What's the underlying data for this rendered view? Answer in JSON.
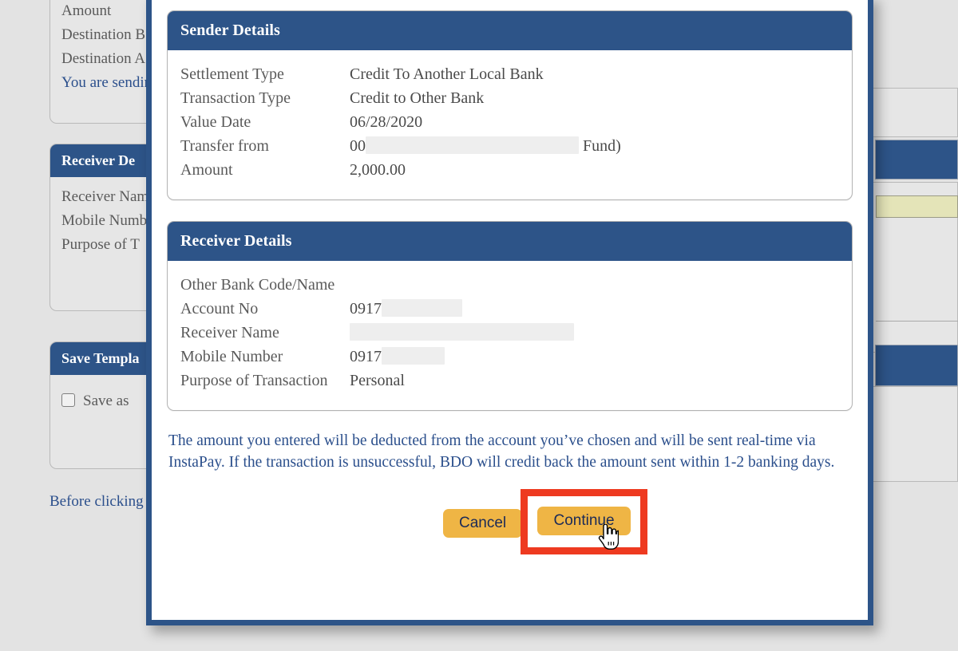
{
  "background": {
    "top_panel_rows": [
      "Amount",
      "Destination B",
      "Destination A",
      "You are sendin"
    ],
    "receiver_panel": {
      "title": "Receiver De",
      "rows": [
        "Receiver Nam",
        "",
        "Mobile Numb",
        "Purpose of T"
      ]
    },
    "save_template_panel": {
      "title": "Save Templa",
      "checkbox_label": "Save as"
    },
    "footer_note": "Before clicking"
  },
  "modal": {
    "sender": {
      "title": "Sender Details",
      "rows": [
        {
          "label": "Settlement Type",
          "value": "Credit To Another Local Bank",
          "redacted": false
        },
        {
          "label": "Transaction Type",
          "value": "Credit to Other Bank",
          "redacted": false
        },
        {
          "label": "Value Date",
          "value": "06/28/2020",
          "redacted": false
        },
        {
          "label": "Transfer from",
          "value_prefix": "00",
          "value_suffix": " Fund)",
          "redacted": "from"
        },
        {
          "label": "Amount",
          "value": "2,000.00",
          "redacted": false
        }
      ]
    },
    "receiver": {
      "title": "Receiver Details",
      "rows": [
        {
          "label": "Other Bank Code/Name",
          "value": "",
          "redacted": false
        },
        {
          "label": "Account No",
          "value_prefix": "0917",
          "value_suffix": "",
          "redacted": "acct"
        },
        {
          "label": "Receiver Name",
          "value_prefix": "",
          "value_suffix": "",
          "redacted": "name"
        },
        {
          "label": "Mobile Number",
          "value_prefix": "0917",
          "value_suffix": "",
          "redacted": "mobile"
        },
        {
          "label": "Purpose of Transaction",
          "value": "Personal",
          "redacted": false
        }
      ]
    },
    "disclaimer": "The amount you entered will be deducted from the account you’ve chosen and will be sent real-time via InstaPay. If the transaction is unsuccessful, BDO will credit back the amount sent within 1-2 banking days.",
    "buttons": {
      "cancel_label": "Cancel",
      "continue_label": "Continue"
    }
  },
  "colors": {
    "header_blue": "#2d5488",
    "button_amber": "#efb545",
    "button_text": "#1b2a57",
    "highlight_red": "#ee3a20",
    "link_blue": "#2b4f8c",
    "page_background": "#e3e3e3",
    "field_khaki": "#e4e4b8"
  }
}
